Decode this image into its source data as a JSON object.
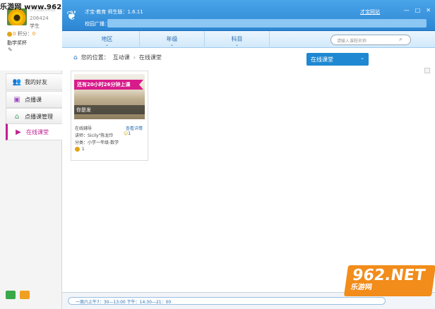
{
  "watermark": {
    "top_left": "乐游网 www.962.net"
  },
  "profile": {
    "name": "(redacted)",
    "id": "206424",
    "role": "学生",
    "coins": "0",
    "points_label": "积分：",
    "points": "0",
    "badge": "勤学奖杯"
  },
  "sidebar": {
    "items": [
      {
        "label": "我的好友",
        "icon": "friends-icon"
      },
      {
        "label": "点播课",
        "icon": "video-icon"
      },
      {
        "label": "点播课管理",
        "icon": "manage-icon"
      },
      {
        "label": "在线课堂",
        "icon": "classroom-icon"
      }
    ]
  },
  "header": {
    "title": "才宝·教育  师生版：1.6.11",
    "link": "才宝网站",
    "broadcast_label": "校园广播：",
    "window_controls": [
      "—",
      "□",
      "✕"
    ]
  },
  "tabs": [
    {
      "label": "地区"
    },
    {
      "label": "年级"
    },
    {
      "label": "科目"
    }
  ],
  "search": {
    "placeholder": "请输入课程名称"
  },
  "breadcrumb": {
    "label": "您的位置：",
    "path1": "互动课",
    "sep": "›",
    "path2": "在线课堂"
  },
  "dropdown": {
    "selected": "在线课堂"
  },
  "course": {
    "ribbon": "还有20小时26分钟上课",
    "caption": "你是发",
    "type": "在线辅导",
    "detail_link": "查看详情",
    "teacher": "讲师：Sicily\"陈龙玲",
    "learners": "1",
    "category": "分类：小学一年级-数学",
    "coins": "1"
  },
  "status": {
    "schedule": "一周六上午7：30—13:00        下午：14:30—21：00"
  },
  "brand": {
    "main": "962.NET",
    "sub": "乐游网"
  },
  "colors": {
    "accent": "#2d86d3",
    "highlight": "#d81b8a",
    "brand": "#f28c1a"
  }
}
